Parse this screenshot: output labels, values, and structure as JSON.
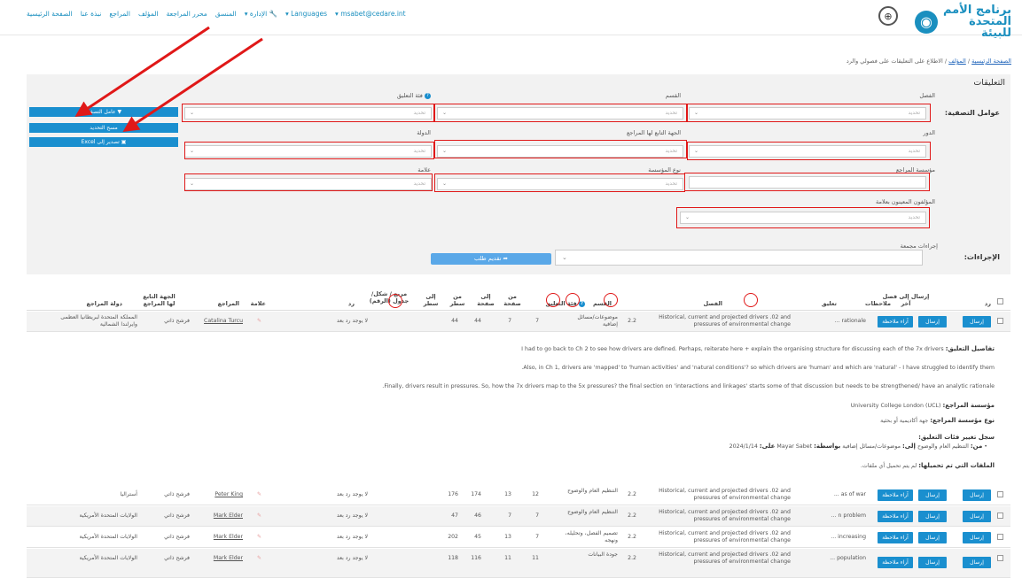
{
  "brand": {
    "line1": "برنامج الأمم",
    "line2": "المتحدة للبيئة",
    "logo_icon": "un-environment-logo-icon",
    "partner_icon": "ipbes-logo-icon"
  },
  "nav": {
    "items": [
      "الصفحة الرئيسية",
      "نبذة عنا",
      "المراجع",
      "المؤلف",
      "محرر المراجعة",
      "المنسق",
      "الإدارة",
      "Languages",
      "msabet@cedare.int"
    ],
    "admin_icon": "wrench-icon"
  },
  "breadcrumb": {
    "home": "الصفحة الرئيسية",
    "sep": "/",
    "author": "المؤلف",
    "current": "الاطلاع على التعليقات على فصولي والرد"
  },
  "panel": {
    "title": "التعليقات",
    "filters_label": "عوامل التصفية:",
    "actions_label": "الإجراءات:",
    "fields": {
      "chapter": "الفصل",
      "section": "القسم",
      "category": "فئة التعليق",
      "role": "الدور",
      "reviewer_body": "الجهة التابع لها المراجع",
      "country": "الدولة",
      "reviewer_org": "مؤسسة المراجع",
      "org_type": "نوع المؤسسة",
      "tag": "علامة",
      "assigned_authors": "المؤلفون المعينون بعلامة",
      "bulk_actions": "إجراءات مجمعة"
    },
    "placeholder": "تحديد",
    "buttons": {
      "apply": "عامل التصفية",
      "clear": "مسح التحديد",
      "export": "تصدير إلى Excel",
      "submit": "تقديم طلب"
    },
    "icons": {
      "filter": "filter-icon",
      "export": "excel-file-icon",
      "submit": "send-arrow-icon"
    }
  },
  "table": {
    "headers": {
      "reply": "رد",
      "send_chapter": "إرسال إلى فصل آخر",
      "notes": "ملاحظات",
      "comment": "تعليق",
      "chapter": "الفصل",
      "section": "القسم",
      "category": "فئة التعليق",
      "from_page": "من صفحة",
      "to_page": "إلى صفحة",
      "from_line": "من سطر",
      "to_line": "إلى سطر",
      "box": "مربع / شكل/جدول (الرقم)",
      "reply2": "رد",
      "tag": "علامة",
      "reviewer": "المراجع",
      "reviewer_body": "الجهة التابع لها المراجع",
      "reviewer_country": "دولة المراجع"
    },
    "send_btn": "إرسال",
    "notes_btn": "آراء ملاحظة",
    "rows": [
      {
        "comment": "rationale ...",
        "chapter": "Historical, current and projected drivers .02 and pressures of environmental change",
        "section": "2.2",
        "category": "موضوعات/مسائل إضافية",
        "from_page": "7",
        "to_page": "7",
        "from_line": "44",
        "to_line": "44",
        "reply": "لا يوجد رد بعد",
        "reviewer": "Catalina Turcu",
        "body": "فرشح ذاتي",
        "country": "المملكة المتحدة لبريطانيا العظمى وايرلندا الشمالية"
      },
      {
        "comment": "as of war ...",
        "chapter": "Historical, current and projected drivers .02 and pressures of environmental change",
        "section": "2.2",
        "category": "التنظيم العام والوضوح",
        "from_page": "12",
        "to_page": "13",
        "from_line": "174",
        "to_line": "176",
        "reply": "لا يوجد رد بعد",
        "reviewer": "Peter King",
        "body": "فرشح ذاتي",
        "country": "أستراليا"
      },
      {
        "comment": "n problem ...",
        "chapter": "Historical, current and projected drivers .02 and pressures of environmental change",
        "section": "2.2",
        "category": "التنظيم العام والوضوح",
        "from_page": "7",
        "to_page": "7",
        "from_line": "46",
        "to_line": "47",
        "reply": "لا يوجد رد بعد",
        "reviewer": "Mark Elder",
        "body": "فرشح ذاتي",
        "country": "الولايات المتحدة الأمريكية"
      },
      {
        "comment": "increasing ...",
        "chapter": "Historical, current and projected drivers .02 and pressures of environmental change",
        "section": "2.2",
        "category": "تصميم الفصل، وتحليله، ونهجه",
        "from_page": "7",
        "to_page": "13",
        "from_line": "45",
        "to_line": "202",
        "reply": "لا يوجد رد بعد",
        "reviewer": "Mark Elder",
        "body": "فرشح ذاتي",
        "country": "الولايات المتحدة الأمريكية"
      },
      {
        "comment": "population ...",
        "chapter": "Historical, current and projected drivers .02 and pressures of environmental change",
        "section": "2.2",
        "category": "جودة البيانات",
        "from_page": "11",
        "to_page": "11",
        "from_line": "116",
        "to_line": "118",
        "reply": "لا يوجد رد بعد",
        "reviewer": "Mark Elder",
        "body": "فرشح ذاتي",
        "country": "الولايات المتحدة الأمريكية"
      }
    ]
  },
  "details": {
    "label": "تفاصيل التعليق:",
    "line1": "I had to go back to Ch 2 to see how drivers are defined. Perhaps, reiterate here + explain the organising structure for discussing each of the 7x drivers",
    "line2": "Also, in Ch 1, drivers are 'mapped' to 'human activities' and 'natural conditions'? so which drivers are 'human' and which are 'natural' - I have struggled to identify them.",
    "line3": "Finally, drivers result in pressures. So, how the 7x drivers map to the 5x pressures? the final section on 'interactions and linkages' starts some of that discussion but needs to be strengthened/ have an analytic rationale.",
    "org_label": "مؤسسة المراجع:",
    "org_value": "University College London (UCL)",
    "org_type_label": "نوع مؤسسة المراجع:",
    "org_type_value": "جهة أكاديمية أو بحثية",
    "history_label": "سجل تغيير فئات التعليق:",
    "history_from_label": "من:",
    "history_from": "التنظيم العام والوضوح",
    "history_to_label": "إلى:",
    "history_to": "موضوعات/مسائل إضافية",
    "history_by_label": "بواسطة:",
    "history_by": "Mayar Sabet",
    "history_on_label": "على:",
    "history_on": "2024/1/14",
    "files_label": "الملفات التي تم تحميلها:",
    "files_value": "لم يتم تحميل أي ملفات."
  },
  "colors": {
    "brand": "#1a8fbf",
    "button": "#1a8fcf",
    "annotation": "#e01818"
  }
}
